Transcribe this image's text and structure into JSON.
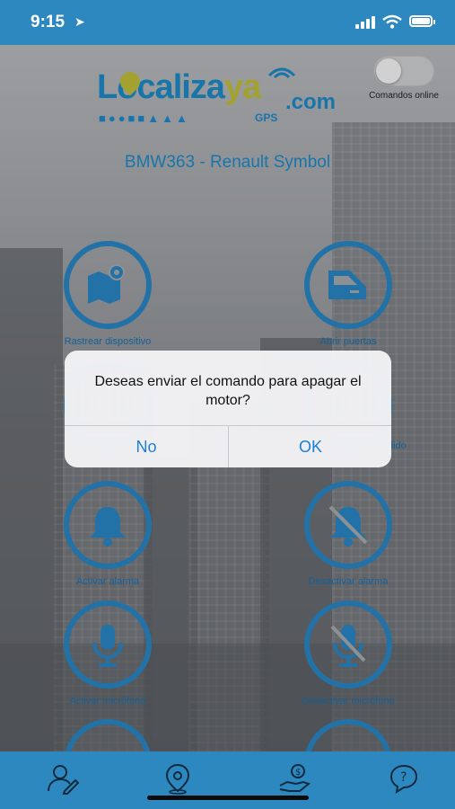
{
  "status_bar": {
    "time": "9:15",
    "location_arrow": "location-arrow-icon"
  },
  "logo": {
    "main": "Localiza",
    "ya": "ya",
    "com": ".com",
    "gps": "GPS"
  },
  "online_toggle": {
    "label": "Comandos online",
    "state": "off"
  },
  "vehicle_title": "BMW363 - Renault Symbol",
  "commands": [
    {
      "label": "Rastrear dispositivo",
      "icon": "map-pin-icon"
    },
    {
      "label": "Abrir puertas",
      "icon": "car-door-icon"
    },
    {
      "label": "Activar alarma",
      "icon": "bell-icon"
    },
    {
      "label": "Desactivar alarma",
      "icon": "bell-off-icon"
    },
    {
      "label": "Activar micrófono",
      "icon": "microphone-icon"
    },
    {
      "label": "Desactivar micrófono",
      "icon": "microphone-off-icon"
    }
  ],
  "partial_label": "dido",
  "dialog": {
    "message": "Deseas enviar el comando para apagar el motor?",
    "cancel_label": "No",
    "ok_label": "OK"
  },
  "tab_bar": [
    "user-edit-icon",
    "location-pin-icon",
    "money-hand-icon",
    "help-chat-icon"
  ],
  "colors": {
    "brand_blue": "#2e88c0",
    "accent_yellow": "#c7c63b",
    "link_blue": "#1a7fd6"
  }
}
